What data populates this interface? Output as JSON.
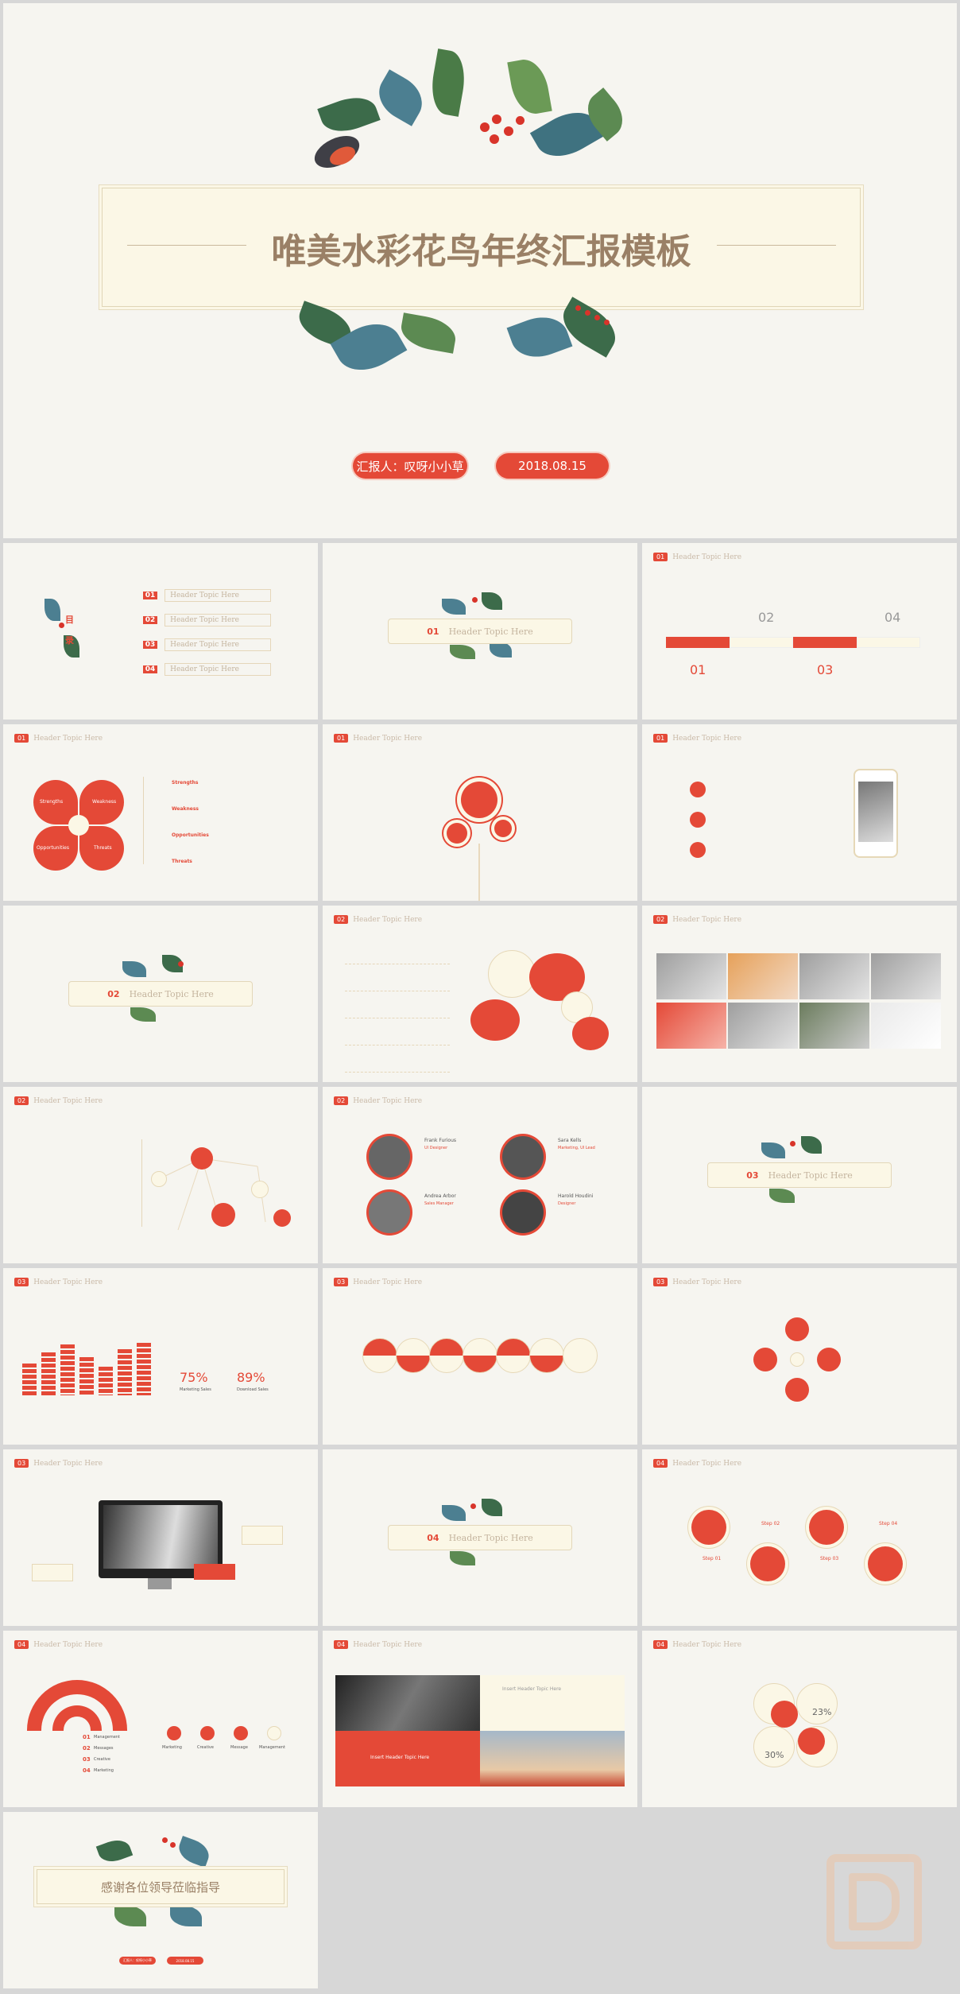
{
  "cover": {
    "title": "唯美水彩花鸟年终汇报模板",
    "reporter": "汇报人：叹呀小小草",
    "date": "2018.08.15"
  },
  "toc": {
    "side_title_1": "目",
    "side_title_2": "录",
    "items": [
      {
        "num": "01",
        "label": "Header Topic Here"
      },
      {
        "num": "02",
        "label": "Header Topic Here"
      },
      {
        "num": "03",
        "label": "Header Topic Here"
      },
      {
        "num": "04",
        "label": "Header Topic Here"
      }
    ]
  },
  "section_header": "Header Topic Here",
  "section_nums": {
    "s1": "01",
    "s2": "02",
    "s3": "03",
    "s4": "04"
  },
  "timeline": {
    "labels": [
      "01",
      "02",
      "03",
      "04"
    ]
  },
  "swot": {
    "petals": [
      "Strengths",
      "Weakness",
      "Opportunities",
      "Threats"
    ]
  },
  "stats": {
    "p1": "75%",
    "p2": "89%",
    "p1_label": "Marketing Sales",
    "p2_label": "Download Sales"
  },
  "percent": {
    "a": "23%",
    "b": "30%"
  },
  "steps": {
    "a": "Step 01",
    "b": "Step 02",
    "c": "Step 03",
    "d": "Step 04"
  },
  "semicircle": {
    "items": [
      {
        "n": "01",
        "t": "Management"
      },
      {
        "n": "02",
        "t": "Messages"
      },
      {
        "n": "03",
        "t": "Creative"
      },
      {
        "n": "04",
        "t": "Marketing"
      }
    ]
  },
  "icons_row": [
    "Marketing",
    "Creative",
    "Message",
    "Management"
  ],
  "photo_slide": {
    "caption": "Insert Header Topic Here",
    "banner": "Insert Header Topic Here"
  },
  "team": [
    {
      "name": "Frank Furious",
      "role": "UI Designer"
    },
    {
      "name": "Sara Kells",
      "role": "Marketing, UI Lead"
    },
    {
      "name": "Andrea Arbor",
      "role": "Sales Manager"
    },
    {
      "name": "Harold Houdini",
      "role": "Designer"
    }
  ],
  "closing": {
    "title": "感谢各位领导莅临指导",
    "reporter": "汇报人：叹呀小小草",
    "date": "2018.08.15"
  },
  "colors": {
    "accent": "#e44937",
    "cream": "#fbf7e6",
    "bg": "#f6f5f0"
  }
}
